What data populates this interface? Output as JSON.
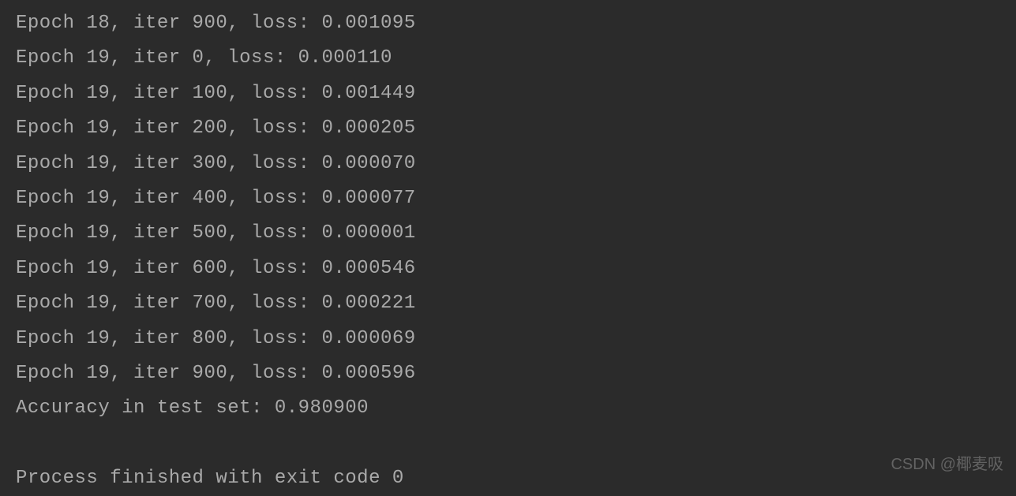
{
  "console": {
    "lines": [
      "Epoch 18, iter 900, loss: 0.001095",
      "Epoch 19, iter 0, loss: 0.000110",
      "Epoch 19, iter 100, loss: 0.001449",
      "Epoch 19, iter 200, loss: 0.000205",
      "Epoch 19, iter 300, loss: 0.000070",
      "Epoch 19, iter 400, loss: 0.000077",
      "Epoch 19, iter 500, loss: 0.000001",
      "Epoch 19, iter 600, loss: 0.000546",
      "Epoch 19, iter 700, loss: 0.000221",
      "Epoch 19, iter 800, loss: 0.000069",
      "Epoch 19, iter 900, loss: 0.000596",
      "Accuracy in test set: 0.980900"
    ],
    "exit_message": "Process finished with exit code 0"
  },
  "watermark": "CSDN @椰麦吸"
}
